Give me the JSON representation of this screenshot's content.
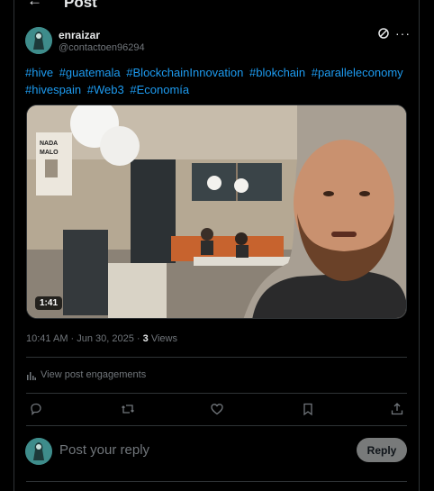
{
  "header": {
    "back_icon": "arrow-left-icon",
    "title": "Post"
  },
  "author": {
    "name": "enraizar",
    "handle": "@contactoen96294",
    "avatar_color": "#3e8c8b"
  },
  "post": {
    "hashtags": [
      "#hive",
      "#guatemala",
      "#BlockchainInnovation",
      "#blokchain",
      "#paralleleconomy",
      "#hivespain",
      "#Web3",
      "#Economía"
    ],
    "video_duration": "1:41",
    "video_poster_text": "NADA MALO",
    "timestamp": "10:41 AM · Jun 30, 2025 · ",
    "views_count": "3",
    "views_label": " Views"
  },
  "engagements": {
    "label": "View post engagements",
    "icon": "bar-chart-icon"
  },
  "actions": [
    "reply-icon",
    "repost-icon",
    "like-icon",
    "bookmark-icon",
    "share-icon"
  ],
  "reply": {
    "placeholder": "Post your reply",
    "button_label": "Reply"
  },
  "colors": {
    "link": "#1d9bf0",
    "muted": "#71767b",
    "text": "#e7e9ea",
    "border": "#2f3336"
  }
}
